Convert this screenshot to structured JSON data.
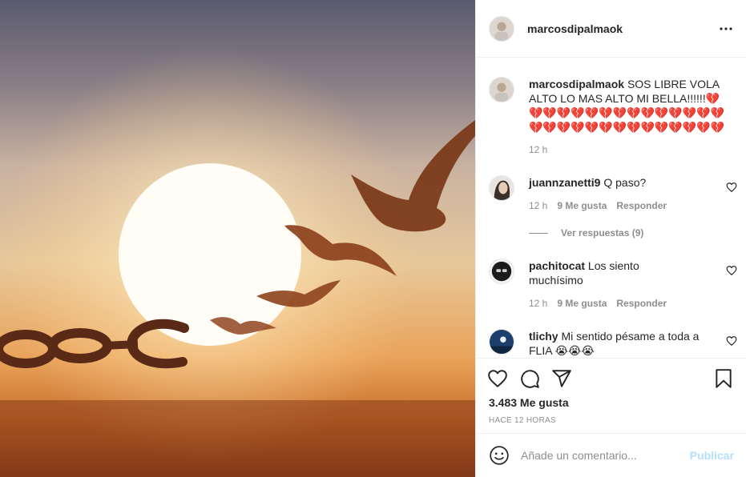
{
  "post": {
    "username": "marcosdipalmaok",
    "caption": {
      "username": "marcosdipalmaok",
      "text": "SOS LIBRE VOLA ALTO LO MAS ALTO MI BELLA!!!!!!💔💔💔💔💔💔💔💔💔💔💔💔💔💔💔💔💔💔💔💔💔💔💔💔💔💔💔💔💔",
      "time": "12 h"
    },
    "comments": [
      {
        "username": "juannzanetti9",
        "text": "Q paso?",
        "time": "12 h",
        "likes": "9 Me gusta",
        "reply": "Responder",
        "view_replies": "Ver respuestas (9)"
      },
      {
        "username": "pachitocat",
        "text": "Los siento muchísimo",
        "time": "12 h",
        "likes": "9 Me gusta",
        "reply": "Responder"
      },
      {
        "username": "tlichy",
        "text": "Mi sentido pésame a toda a FLIA 😭😭😭"
      }
    ],
    "likes": "3.483 Me gusta",
    "timestamp": "HACE 12 HORAS",
    "add_comment": {
      "placeholder": "Añade un comentario...",
      "publish": "Publicar"
    }
  },
  "icons": {
    "more": "more-options-icon",
    "like": "heart-icon",
    "comment": "comment-icon",
    "share": "share-icon",
    "save": "bookmark-icon",
    "emoji": "emoji-icon"
  },
  "colors": {
    "text": "#262626",
    "secondary": "#8e8e8e",
    "divider": "#efefef",
    "publish_disabled": "#b2dffc"
  }
}
